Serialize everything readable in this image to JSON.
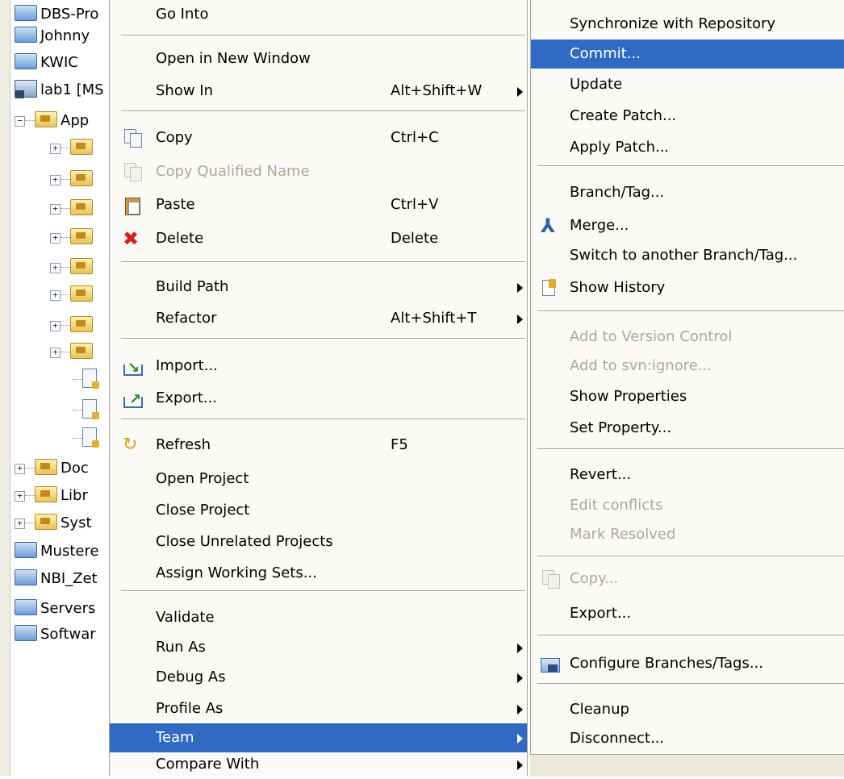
{
  "tree": {
    "items": [
      {
        "label": "DBS-Pro",
        "icon": "folder-icon",
        "expander": false
      },
      {
        "label": "Johnny",
        "icon": "folder-icon",
        "expander": false
      },
      {
        "label": "KWIC",
        "icon": "folder-icon",
        "expander": false
      },
      {
        "label": "lab1 [MS",
        "icon": "project-icon",
        "expander": false
      },
      {
        "label": "App",
        "icon": "package-folder-icon",
        "expander": "minus"
      },
      {
        "label": "",
        "icon": "package-folder-icon",
        "expander": "plus"
      },
      {
        "label": "",
        "icon": "package-folder-icon",
        "expander": "plus"
      },
      {
        "label": "",
        "icon": "package-folder-icon",
        "expander": "plus"
      },
      {
        "label": "",
        "icon": "package-folder-icon",
        "expander": "plus"
      },
      {
        "label": "",
        "icon": "package-folder-icon",
        "expander": "plus"
      },
      {
        "label": "",
        "icon": "package-folder-icon",
        "expander": "plus"
      },
      {
        "label": "",
        "icon": "package-folder-icon",
        "expander": "plus"
      },
      {
        "label": "",
        "icon": "package-folder-icon",
        "expander": "plus"
      },
      {
        "label": "",
        "icon": "file-icon",
        "expander": false
      },
      {
        "label": "",
        "icon": "file-icon",
        "expander": false
      },
      {
        "label": "",
        "icon": "file-icon",
        "expander": false
      },
      {
        "label": "Doc",
        "icon": "package-folder-icon",
        "expander": "plus"
      },
      {
        "label": "Libr",
        "icon": "package-folder-icon",
        "expander": "plus"
      },
      {
        "label": "Syst",
        "icon": "package-folder-icon",
        "expander": "plus"
      },
      {
        "label": "Mustere",
        "icon": "folder-icon",
        "expander": false
      },
      {
        "label": "NBI_Zet",
        "icon": "folder-icon",
        "expander": false
      },
      {
        "label": "Servers",
        "icon": "folder-icon",
        "expander": false
      },
      {
        "label": "Softwar",
        "icon": "folder-icon",
        "expander": false
      }
    ]
  },
  "context_menu": {
    "items": [
      {
        "label": "Go Into",
        "accel": "",
        "submenu": false,
        "disabled": false,
        "icon": ""
      },
      {
        "sep": true
      },
      {
        "label": "Open in New Window",
        "accel": "",
        "submenu": false,
        "disabled": false,
        "icon": ""
      },
      {
        "label": "Show In",
        "accel": "Alt+Shift+W",
        "submenu": true,
        "disabled": false,
        "icon": ""
      },
      {
        "sep": true
      },
      {
        "label": "Copy",
        "accel": "Ctrl+C",
        "submenu": false,
        "disabled": false,
        "icon": "copy-icon"
      },
      {
        "label": "Copy Qualified Name",
        "accel": "",
        "submenu": false,
        "disabled": true,
        "icon": "copy-icon"
      },
      {
        "label": "Paste",
        "accel": "Ctrl+V",
        "submenu": false,
        "disabled": false,
        "icon": "paste-icon"
      },
      {
        "label": "Delete",
        "accel": "Delete",
        "submenu": false,
        "disabled": false,
        "icon": "delete-icon"
      },
      {
        "sep": true
      },
      {
        "label": "Build Path",
        "accel": "",
        "submenu": true,
        "disabled": false,
        "icon": ""
      },
      {
        "label": "Refactor",
        "accel": "Alt+Shift+T",
        "submenu": true,
        "disabled": false,
        "icon": ""
      },
      {
        "sep": true
      },
      {
        "label": "Import...",
        "accel": "",
        "submenu": false,
        "disabled": false,
        "icon": "import-icon"
      },
      {
        "label": "Export...",
        "accel": "",
        "submenu": false,
        "disabled": false,
        "icon": "export-icon"
      },
      {
        "sep": true
      },
      {
        "label": "Refresh",
        "accel": "F5",
        "submenu": false,
        "disabled": false,
        "icon": "refresh-icon"
      },
      {
        "label": "Open Project",
        "accel": "",
        "submenu": false,
        "disabled": false,
        "icon": ""
      },
      {
        "label": "Close Project",
        "accel": "",
        "submenu": false,
        "disabled": false,
        "icon": ""
      },
      {
        "label": "Close Unrelated Projects",
        "accel": "",
        "submenu": false,
        "disabled": false,
        "icon": ""
      },
      {
        "label": "Assign Working Sets...",
        "accel": "",
        "submenu": false,
        "disabled": false,
        "icon": ""
      },
      {
        "sep": true
      },
      {
        "label": "Validate",
        "accel": "",
        "submenu": false,
        "disabled": false,
        "icon": ""
      },
      {
        "label": "Run As",
        "accel": "",
        "submenu": true,
        "disabled": false,
        "icon": ""
      },
      {
        "label": "Debug As",
        "accel": "",
        "submenu": true,
        "disabled": false,
        "icon": ""
      },
      {
        "label": "Profile As",
        "accel": "",
        "submenu": true,
        "disabled": false,
        "icon": ""
      },
      {
        "label": "Team",
        "accel": "",
        "submenu": true,
        "disabled": false,
        "icon": "",
        "selected": true
      },
      {
        "label": "Compare With",
        "accel": "",
        "submenu": true,
        "disabled": false,
        "icon": ""
      }
    ]
  },
  "team_submenu": {
    "items": [
      {
        "label": "Synchronize with Repository",
        "disabled": false,
        "icon": ""
      },
      {
        "label": "Commit...",
        "disabled": false,
        "icon": "",
        "selected": true
      },
      {
        "label": "Update",
        "disabled": false,
        "icon": ""
      },
      {
        "label": "Create Patch...",
        "disabled": false,
        "icon": ""
      },
      {
        "label": "Apply Patch...",
        "disabled": false,
        "icon": ""
      },
      {
        "sep": true
      },
      {
        "label": "Branch/Tag...",
        "disabled": false,
        "icon": ""
      },
      {
        "label": "Merge...",
        "disabled": false,
        "icon": "merge-icon"
      },
      {
        "label": "Switch to another Branch/Tag...",
        "disabled": false,
        "icon": ""
      },
      {
        "label": "Show History",
        "disabled": false,
        "icon": "history-icon"
      },
      {
        "sep": true
      },
      {
        "label": "Add to Version Control",
        "disabled": true,
        "icon": ""
      },
      {
        "label": "Add to svn:ignore...",
        "disabled": true,
        "icon": ""
      },
      {
        "label": "Show Properties",
        "disabled": false,
        "icon": ""
      },
      {
        "label": "Set Property...",
        "disabled": false,
        "icon": ""
      },
      {
        "sep": true
      },
      {
        "label": "Revert...",
        "disabled": false,
        "icon": ""
      },
      {
        "label": "Edit conflicts",
        "disabled": true,
        "icon": ""
      },
      {
        "label": "Mark Resolved",
        "disabled": true,
        "icon": ""
      },
      {
        "sep": true
      },
      {
        "label": "Copy...",
        "disabled": true,
        "icon": "copy-icon"
      },
      {
        "label": "Export...",
        "disabled": false,
        "icon": ""
      },
      {
        "sep": true
      },
      {
        "label": "Configure Branches/Tags...",
        "disabled": false,
        "icon": "branches-icon"
      },
      {
        "sep": true
      },
      {
        "label": "Cleanup",
        "disabled": false,
        "icon": ""
      },
      {
        "label": "Disconnect...",
        "disabled": false,
        "icon": ""
      }
    ]
  }
}
